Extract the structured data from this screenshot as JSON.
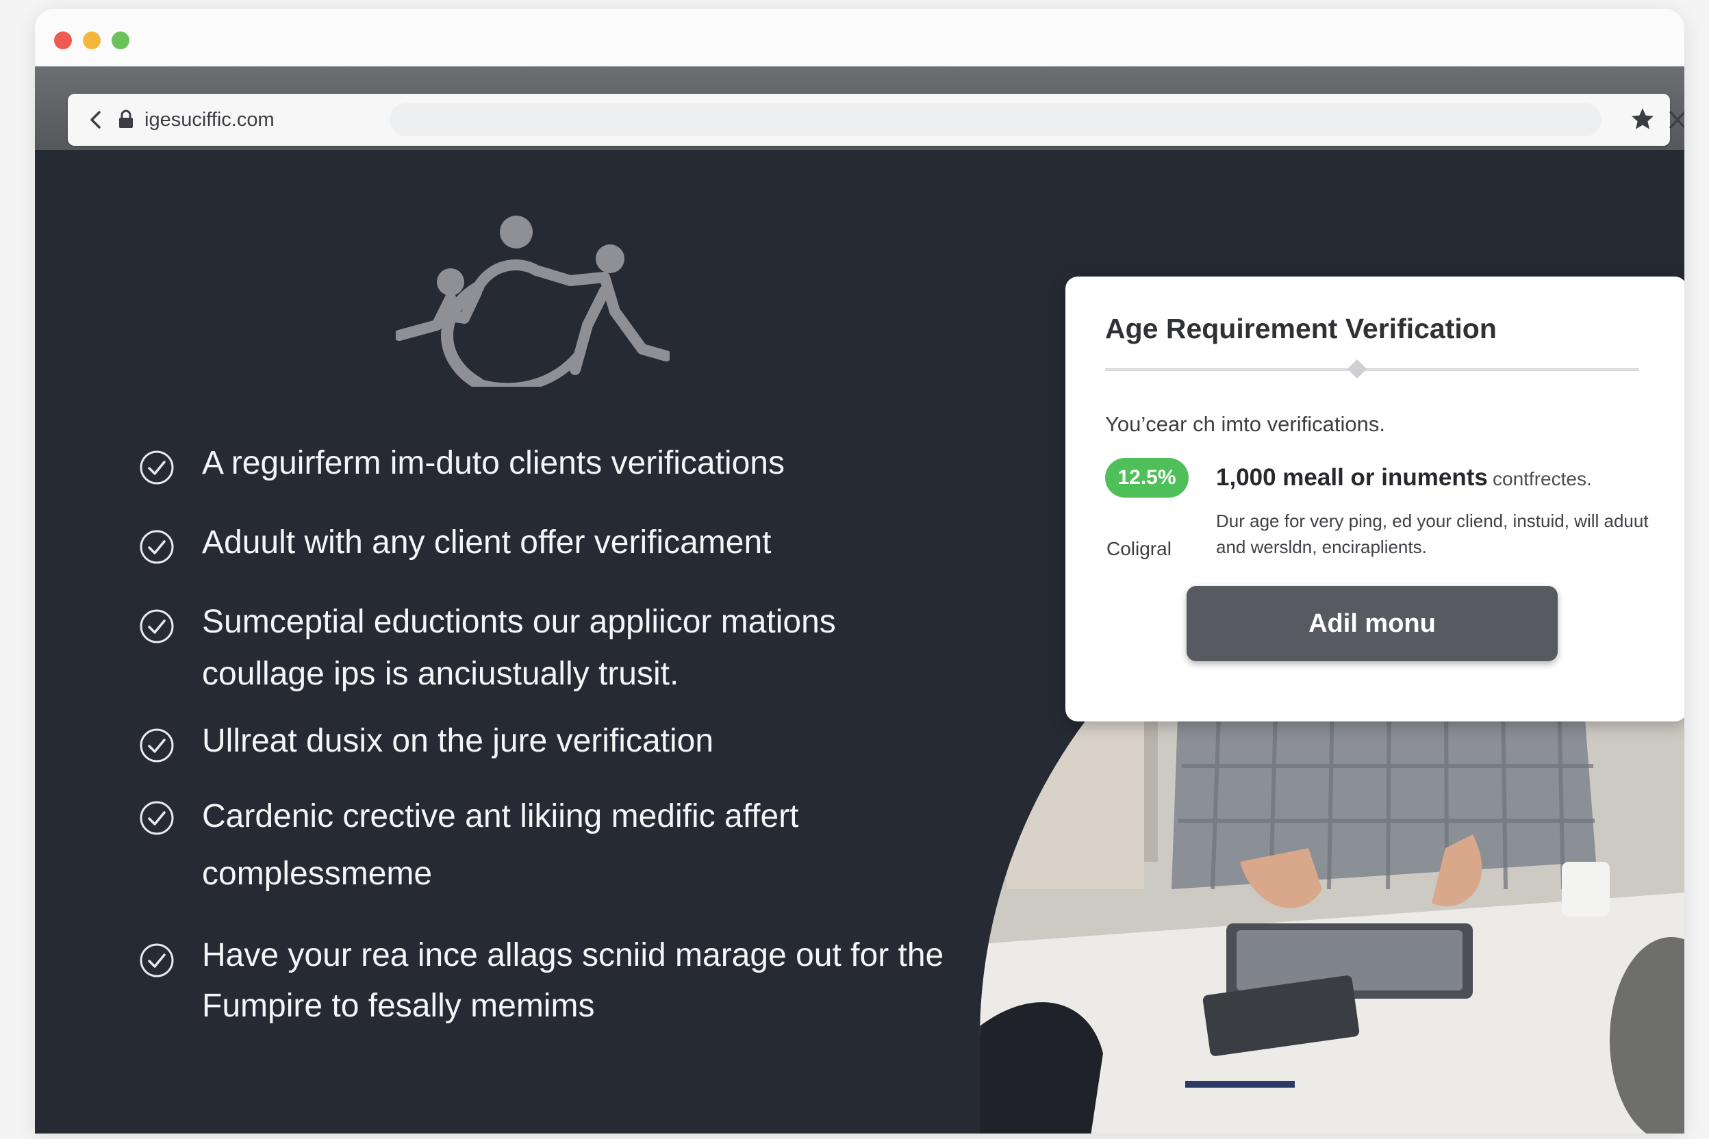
{
  "browser": {
    "url": "igesuciffic.com"
  },
  "features": [
    {
      "text": "A reguirferm im-duto clients verifications"
    },
    {
      "text": "Aduult with any client offer verificament"
    },
    {
      "text": "Sumceptial eductionts our appliicor mations coullage ips is anciustually trusit."
    },
    {
      "text": "Ullreat dusix on the jure verification"
    },
    {
      "text": "Cardenic crective ant likiing medific affert complessmeme"
    },
    {
      "text": "Have your rea ince allags scniid marage out for the Fumpire to fesally memims"
    }
  ],
  "card": {
    "title": "Age Requirement Verification",
    "subtitle": "You’cear ch imto verifications.",
    "badge": "12.5%",
    "stat": "1,000 meall or inuments",
    "stat_suffix": "contfrectes.",
    "label": "Coligral",
    "description": "Dur age for very ping, ed your cliend, instuid, will aduut and wersldn, enciraplients.",
    "cta_label": "Adil monu"
  },
  "icons": {
    "back": "chevron-left-icon",
    "lock": "lock-icon",
    "star": "star-icon",
    "close": "close-icon",
    "check": "check-circle-icon",
    "logo": "people-circle-logo"
  },
  "colors": {
    "page_background": "#262a33",
    "badge_green": "#4fbf59",
    "button_gray": "#575a60"
  }
}
